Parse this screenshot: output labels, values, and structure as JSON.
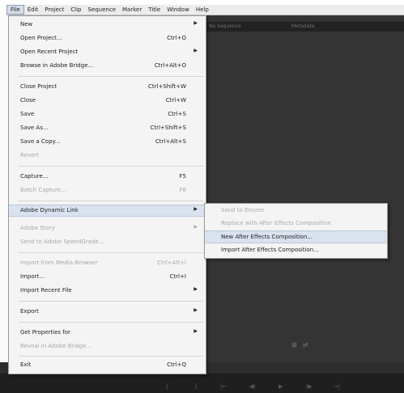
{
  "menubar": {
    "items": [
      "File",
      "Edit",
      "Project",
      "Clip",
      "Sequence",
      "Marker",
      "Title",
      "Window",
      "Help"
    ]
  },
  "panel": {
    "tab1": "No Sequence",
    "tab2": "Metadata"
  },
  "file_menu": {
    "items": [
      {
        "label": "New",
        "shortcut": "",
        "submenu": true,
        "disabled": false
      },
      {
        "label": "Open Project...",
        "shortcut": "Ctrl+O",
        "submenu": false,
        "disabled": false
      },
      {
        "label": "Open Recent Project",
        "shortcut": "",
        "submenu": true,
        "disabled": false
      },
      {
        "label": "Browse in Adobe Bridge...",
        "shortcut": "Ctrl+Alt+O",
        "submenu": false,
        "disabled": false
      },
      {
        "label": "Close Project",
        "shortcut": "Ctrl+Shift+W",
        "submenu": false,
        "disabled": false
      },
      {
        "label": "Close",
        "shortcut": "Ctrl+W",
        "submenu": false,
        "disabled": false
      },
      {
        "label": "Save",
        "shortcut": "Ctrl+S",
        "submenu": false,
        "disabled": false
      },
      {
        "label": "Save As...",
        "shortcut": "Ctrl+Shift+S",
        "submenu": false,
        "disabled": false
      },
      {
        "label": "Save a Copy...",
        "shortcut": "Ctrl+Alt+S",
        "submenu": false,
        "disabled": false
      },
      {
        "label": "Revert",
        "shortcut": "",
        "submenu": false,
        "disabled": true
      },
      {
        "label": "Capture...",
        "shortcut": "F5",
        "submenu": false,
        "disabled": false
      },
      {
        "label": "Batch Capture...",
        "shortcut": "F6",
        "submenu": false,
        "disabled": true
      },
      {
        "label": "Adobe Dynamic Link",
        "shortcut": "",
        "submenu": true,
        "disabled": false
      },
      {
        "label": "Adobe Story",
        "shortcut": "",
        "submenu": true,
        "disabled": true
      },
      {
        "label": "Send to Adobe SpeedGrade...",
        "shortcut": "",
        "submenu": false,
        "disabled": true
      },
      {
        "label": "Import from Media Browser",
        "shortcut": "Ctrl+Alt+I",
        "submenu": false,
        "disabled": true
      },
      {
        "label": "Import...",
        "shortcut": "Ctrl+I",
        "submenu": false,
        "disabled": false
      },
      {
        "label": "Import Recent File",
        "shortcut": "",
        "submenu": true,
        "disabled": false
      },
      {
        "label": "Export",
        "shortcut": "",
        "submenu": true,
        "disabled": false
      },
      {
        "label": "Get Properties for",
        "shortcut": "",
        "submenu": true,
        "disabled": false
      },
      {
        "label": "Reveal in Adobe Bridge...",
        "shortcut": "",
        "submenu": false,
        "disabled": true
      },
      {
        "label": "Exit",
        "shortcut": "Ctrl+Q",
        "submenu": false,
        "disabled": false
      }
    ]
  },
  "dynamic_link_submenu": {
    "items": [
      {
        "label": "Send to Encore",
        "disabled": true
      },
      {
        "label": "Replace with After Effects Composition",
        "disabled": true
      },
      {
        "label": "New After Effects Composition...",
        "disabled": false
      },
      {
        "label": "Import After Effects Composition...",
        "disabled": false
      }
    ]
  },
  "arrow_glyph": "▶",
  "transport": [
    "{",
    "}",
    "|←",
    "◀I",
    "▶",
    "I▶",
    "→|",
    "⊞",
    "⇄"
  ]
}
